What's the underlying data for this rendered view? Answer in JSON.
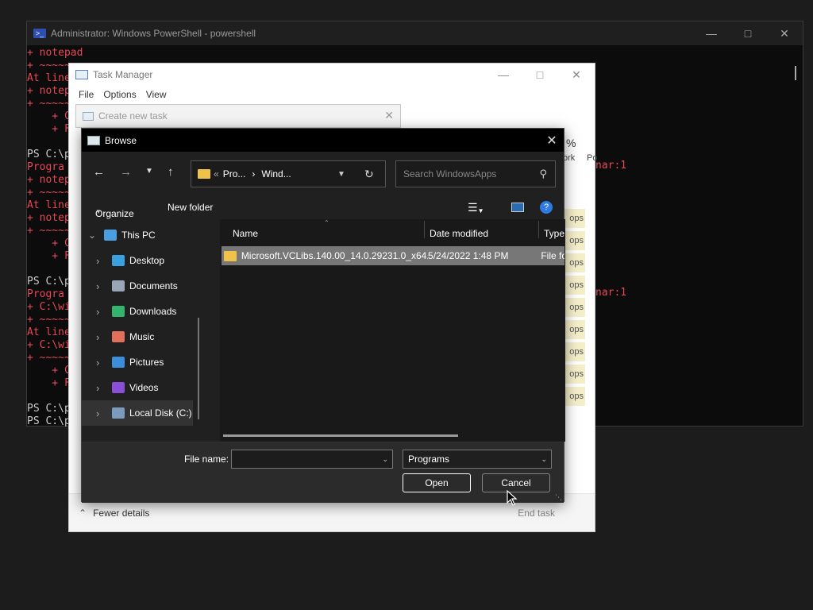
{
  "powershell": {
    "title": "Administrator: Windows PowerShell - powershell",
    "lines": [
      {
        "t": "+ notepad",
        "c": "r"
      },
      {
        "t": "+ ~~~~~~~",
        "c": "r"
      },
      {
        "t": "At line",
        "c": "r"
      },
      {
        "t": "+ notep",
        "c": "r"
      },
      {
        "t": "+ ~~~~~",
        "c": "r"
      },
      {
        "t": "    + C",
        "c": "r"
      },
      {
        "t": "    + F",
        "c": "r"
      },
      {
        "t": "",
        "c": "w"
      },
      {
        "t": "PS C:\\p",
        "c": "w"
      },
      {
        "t": "Progra",
        "c": "r"
      },
      {
        "t": "+ notep",
        "c": "r"
      },
      {
        "t": "+ ~~~~~",
        "c": "r"
      },
      {
        "t": "At line",
        "c": "r"
      },
      {
        "t": "+ notep",
        "c": "r"
      },
      {
        "t": "+ ~~~~~",
        "c": "r"
      },
      {
        "t": "    + C",
        "c": "r"
      },
      {
        "t": "    + F",
        "c": "r"
      },
      {
        "t": "",
        "c": "w"
      },
      {
        "t": "PS C:\\p",
        "c": "w"
      },
      {
        "t": "Progra",
        "c": "r"
      },
      {
        "t": "+ C:\\wi",
        "c": "r"
      },
      {
        "t": "+ ~~~~~",
        "c": "r"
      },
      {
        "t": "At line",
        "c": "r"
      },
      {
        "t": "+ C:\\wi",
        "c": "r"
      },
      {
        "t": "+ ~~~~~",
        "c": "r"
      },
      {
        "t": "    + C",
        "c": "r"
      },
      {
        "t": "    + F",
        "c": "r"
      },
      {
        "t": "",
        "c": "w"
      },
      {
        "t": "PS C:\\p",
        "c": "w"
      },
      {
        "t": "PS C:\\p",
        "c": "w"
      }
    ],
    "right_text_1": "nar:1",
    "right_text_2": "nar:1"
  },
  "taskmanager": {
    "title": "Task Manager",
    "menu": [
      "File",
      "Options",
      "View"
    ],
    "pct": "%",
    "col_network": "ork",
    "col_power": "Po",
    "row_text": "ops",
    "fewer_details": "Fewer details",
    "end_task": "End task"
  },
  "create_task": {
    "title": "Create new task"
  },
  "browse": {
    "title": "Browse",
    "address": {
      "crumb1": "Pro...",
      "crumb2": "Wind..."
    },
    "search_placeholder": "Search WindowsApps",
    "organize": "Organize",
    "new_folder": "New folder",
    "sidebar": [
      {
        "label": "This PC",
        "icon": "this-pc-icon",
        "color": "#4a9fe0"
      },
      {
        "label": "Desktop",
        "icon": "desktop-icon",
        "color": "#3aa0e0"
      },
      {
        "label": "Documents",
        "icon": "documents-icon",
        "color": "#9aa6b8"
      },
      {
        "label": "Downloads",
        "icon": "downloads-icon",
        "color": "#34b36b"
      },
      {
        "label": "Music",
        "icon": "music-icon",
        "color": "#e0705a"
      },
      {
        "label": "Pictures",
        "icon": "pictures-icon",
        "color": "#3b8fd8"
      },
      {
        "label": "Videos",
        "icon": "videos-icon",
        "color": "#8a4fd8"
      },
      {
        "label": "Local Disk (C:)",
        "icon": "local-disk-icon",
        "color": "#7a9bbb"
      }
    ],
    "columns": {
      "name": "Name",
      "date": "Date modified",
      "type": "Type"
    },
    "rows": [
      {
        "name": "Microsoft.VCLibs.140.00_14.0.29231.0_x64...",
        "date": "5/24/2022 1:48 PM",
        "type": "File fo"
      }
    ],
    "file_name_label": "File name:",
    "file_name_value": "",
    "filter": "Programs",
    "open": "Open",
    "cancel": "Cancel"
  }
}
